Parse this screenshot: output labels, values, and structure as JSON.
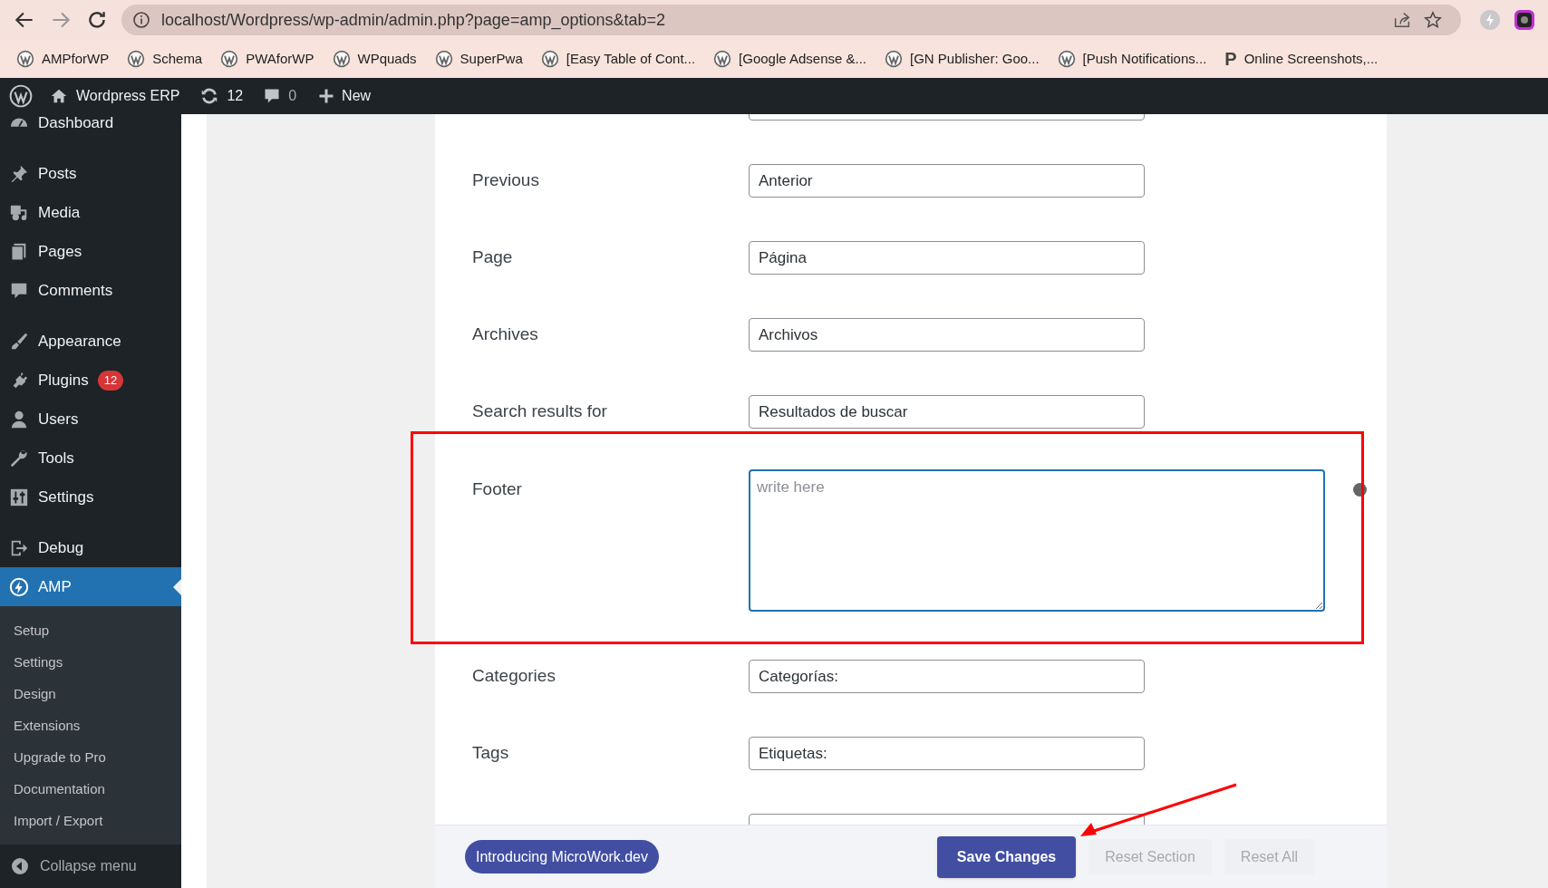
{
  "browser": {
    "url": "localhost/Wordpress/wp-admin/admin.php?page=amp_options&tab=2",
    "bookmarks": [
      {
        "kind": "wp",
        "label": "AMPforWP"
      },
      {
        "kind": "wp",
        "label": "Schema"
      },
      {
        "kind": "wp",
        "label": "PWAforWP"
      },
      {
        "kind": "wp",
        "label": "WPquads"
      },
      {
        "kind": "wp",
        "label": "SuperPwa"
      },
      {
        "kind": "wp",
        "label": "[Easy Table of Cont..."
      },
      {
        "kind": "wp",
        "label": "[Google Adsense &..."
      },
      {
        "kind": "wp",
        "label": "[GN Publisher: Goo..."
      },
      {
        "kind": "wp",
        "label": "[Push Notifications..."
      },
      {
        "kind": "letter",
        "icon_text": "P",
        "label": "Online Screenshots,..."
      }
    ]
  },
  "admin_bar": {
    "site": "Wordpress ERP",
    "updates": "12",
    "comments": "0",
    "new": "New"
  },
  "sidebar": {
    "groups": [
      [
        {
          "label": "Dashboard",
          "selected": false
        }
      ],
      [
        {
          "label": "Posts",
          "selected": false
        },
        {
          "label": "Media",
          "selected": false
        },
        {
          "label": "Pages",
          "selected": false
        },
        {
          "label": "Comments",
          "selected": false
        }
      ],
      [
        {
          "label": "Appearance",
          "selected": false
        },
        {
          "label": "Plugins",
          "selected": false,
          "badge": "12"
        },
        {
          "label": "Users",
          "selected": false
        },
        {
          "label": "Tools",
          "selected": false
        },
        {
          "label": "Settings",
          "selected": false
        }
      ],
      [
        {
          "label": "Debug",
          "selected": false
        },
        {
          "label": "AMP",
          "selected": true,
          "children": [
            {
              "label": "Setup",
              "selected": false
            },
            {
              "label": "Settings",
              "selected": false
            },
            {
              "label": "Design",
              "selected": false
            },
            {
              "label": "Extensions",
              "selected": false
            },
            {
              "label": "Upgrade to Pro",
              "selected": false
            },
            {
              "label": "Documentation",
              "selected": false
            },
            {
              "label": "Import / Export",
              "selected": false
            }
          ]
        }
      ]
    ],
    "collapse": "Collapse menu"
  },
  "form": {
    "rows": [
      {
        "kind": "text",
        "label": "Previous",
        "value": "Anterior"
      },
      {
        "kind": "text",
        "label": "Page",
        "value": "Página"
      },
      {
        "kind": "text",
        "label": "Archives",
        "value": "Archivos"
      },
      {
        "kind": "text",
        "label": "Search results for",
        "value": "Resultados de buscar"
      },
      {
        "kind": "textarea",
        "label": "Footer",
        "placeholder": "write here"
      },
      {
        "kind": "text",
        "label": "Categories",
        "value": "Categorías:"
      },
      {
        "kind": "text",
        "label": "Tags",
        "value": "Etiquetas:"
      }
    ]
  },
  "footer_bar": {
    "promo": "Introducing MicroWork.dev",
    "buttons": [
      {
        "kind": "primary",
        "label": "Save Changes"
      },
      {
        "kind": "secondary",
        "label": "Reset Section"
      },
      {
        "kind": "secondary",
        "label": "Reset All"
      }
    ]
  },
  "annotations": {
    "highlight_frame": true,
    "arrow": true
  }
}
